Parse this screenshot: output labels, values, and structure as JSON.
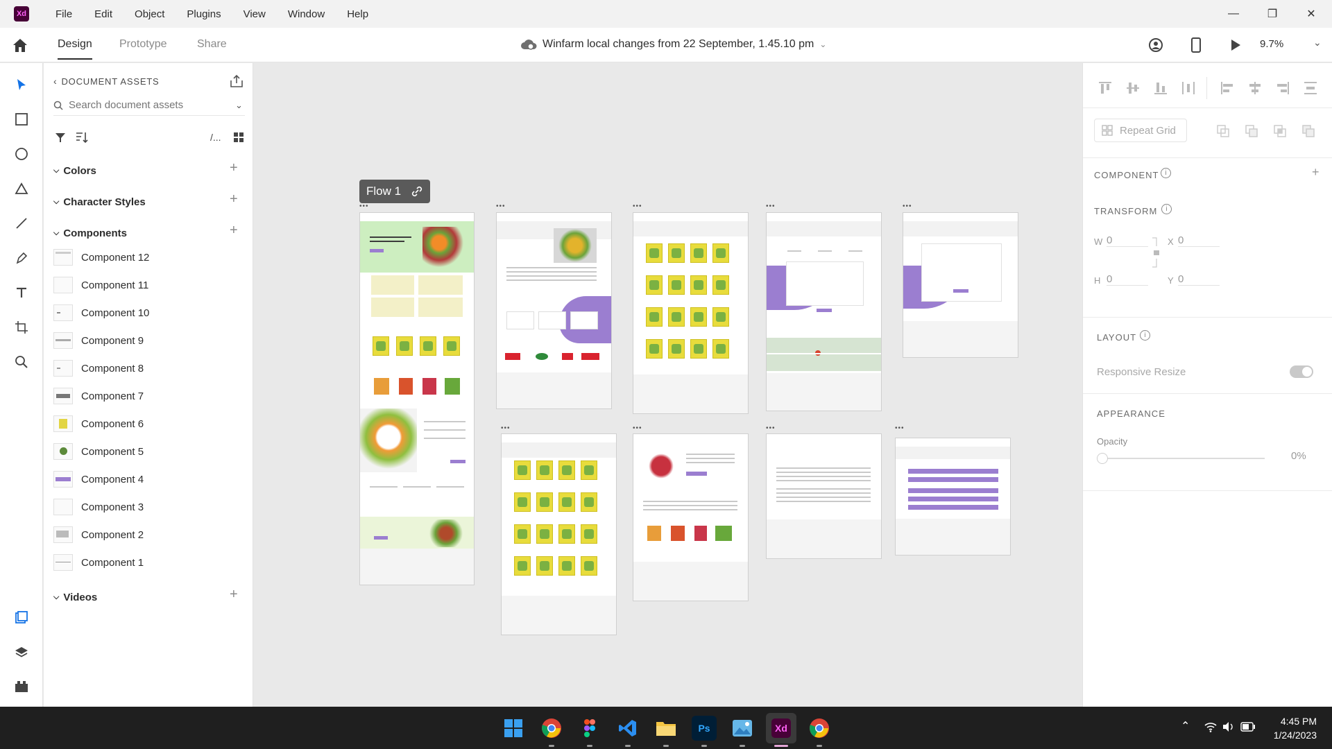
{
  "app": {
    "logo": "Xd",
    "accent": "#470137"
  },
  "menu": [
    "File",
    "Edit",
    "Object",
    "Plugins",
    "View",
    "Window",
    "Help"
  ],
  "tabs": {
    "design": "Design",
    "prototype": "Prototype",
    "share": "Share"
  },
  "document": {
    "title": "Winfarm local changes from 22 September, 1.45.10 pm",
    "zoom": "9.7%"
  },
  "assets": {
    "header": "DOCUMENT ASSETS",
    "search_placeholder": "Search document assets",
    "filter_path": "/...",
    "sections": {
      "colors": "Colors",
      "character_styles": "Character Styles",
      "components": "Components",
      "videos": "Videos"
    },
    "components": [
      "Component 12",
      "Component 11",
      "Component 10",
      "Component 9",
      "Component 8",
      "Component 7",
      "Component 6",
      "Component 5",
      "Component 4",
      "Component 3",
      "Component 2",
      "Component 1"
    ]
  },
  "canvas": {
    "flow_label": "Flow 1",
    "artboard_marker": "•••"
  },
  "right_panel": {
    "repeat_grid": "Repeat Grid",
    "component": "COMPONENT",
    "transform": "TRANSFORM",
    "w_label": "W",
    "w_value": "0",
    "x_label": "X",
    "x_value": "0",
    "h_label": "H",
    "h_value": "0",
    "y_label": "Y",
    "y_value": "0",
    "layout": "LAYOUT",
    "responsive_resize": "Responsive Resize",
    "appearance": "APPEARANCE",
    "opacity_label": "Opacity",
    "opacity_value": "0%"
  },
  "taskbar": {
    "time": "4:45 PM",
    "date": "1/24/2023",
    "apps": [
      "windows-start",
      "chrome",
      "figma",
      "vscode",
      "file-explorer",
      "photoshop",
      "photos",
      "adobe-xd",
      "chrome-alt"
    ]
  }
}
